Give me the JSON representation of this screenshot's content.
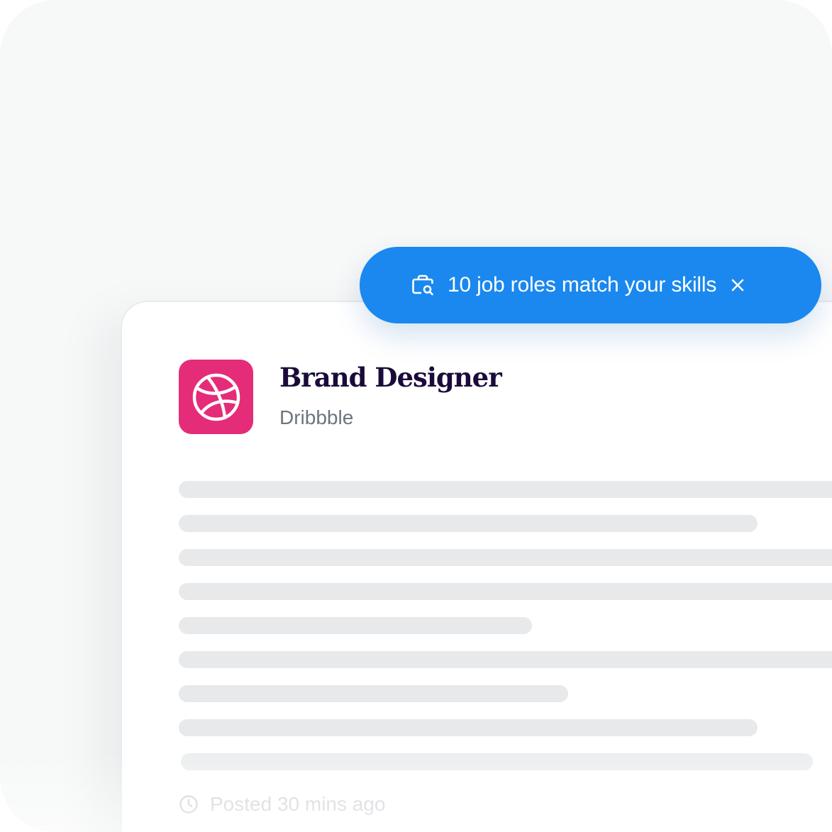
{
  "toast": {
    "icon": "briefcase-search-icon",
    "message": "10 job roles match your skills",
    "close_icon": "close-icon",
    "color": "#1a88ee"
  },
  "job": {
    "title": "Brand Designer",
    "company": "Dribbble",
    "logo_icon": "dribbble-logo-icon",
    "logo_color": "#e52c78",
    "posted": "Posted 30 mins ago",
    "posted_icon": "clock-icon"
  }
}
